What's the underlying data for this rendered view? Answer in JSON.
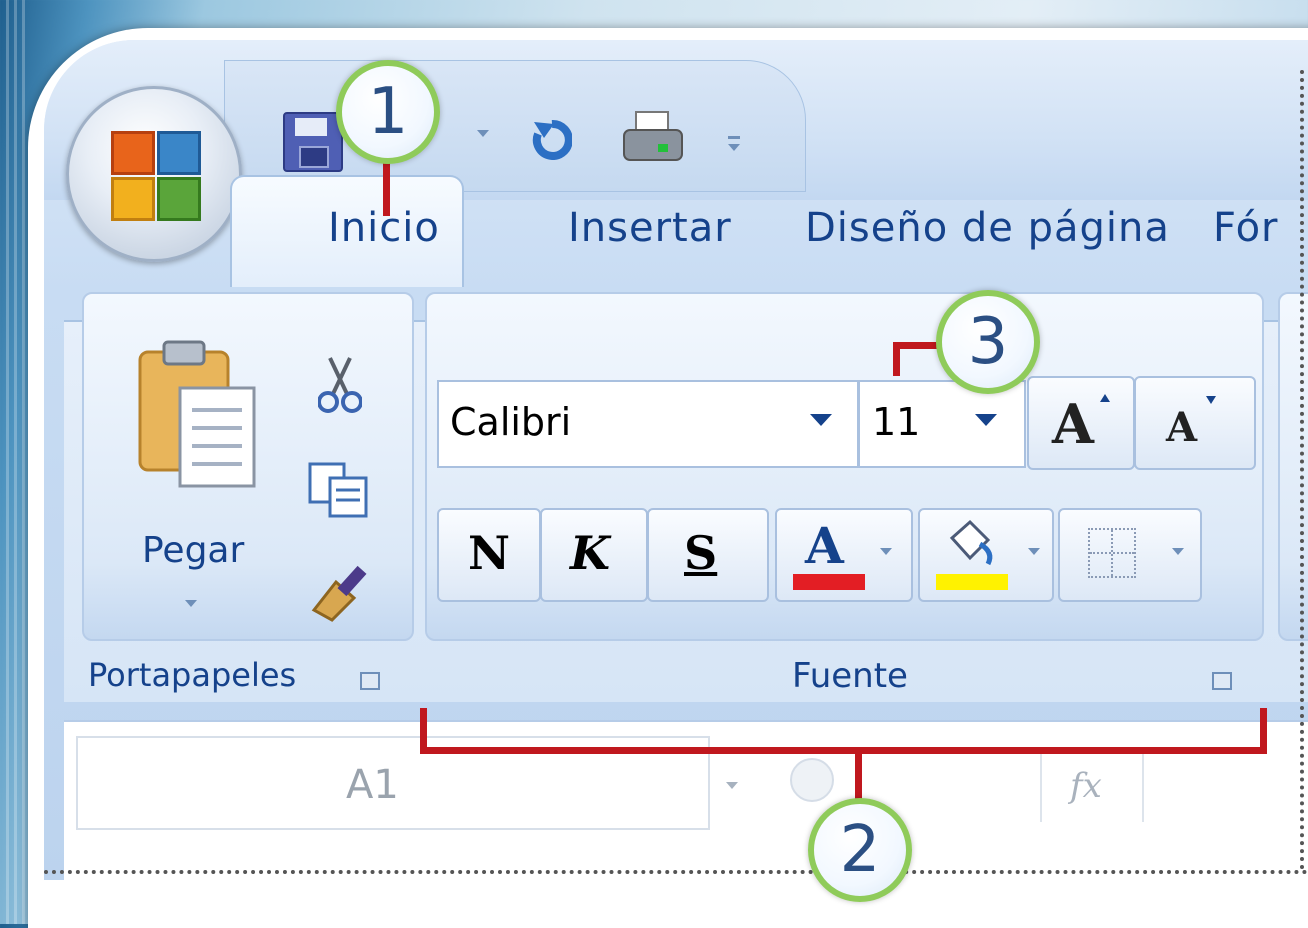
{
  "quick_access": {
    "save_icon": "save-icon",
    "undo_icon": "undo-icon",
    "print_icon": "print-icon"
  },
  "tabs": [
    {
      "label": "Inicio",
      "active": true
    },
    {
      "label": "Insertar"
    },
    {
      "label": "Diseño de página"
    },
    {
      "label": "Fór"
    }
  ],
  "clipboard": {
    "paste_label": "Pegar",
    "group_label": "Portapapeles"
  },
  "font": {
    "name": "Calibri",
    "size": "11",
    "grow_label": "A",
    "shrink_label": "A",
    "bold_label": "N",
    "italic_label": "K",
    "underline_label": "S",
    "font_color_label": "A",
    "font_color": "#e31e24",
    "fill_color": "#fff200",
    "group_label": "Fuente"
  },
  "formula_bar": {
    "cell_ref": "A1",
    "fx_label": "fx"
  },
  "callouts": [
    "1",
    "2",
    "3"
  ]
}
